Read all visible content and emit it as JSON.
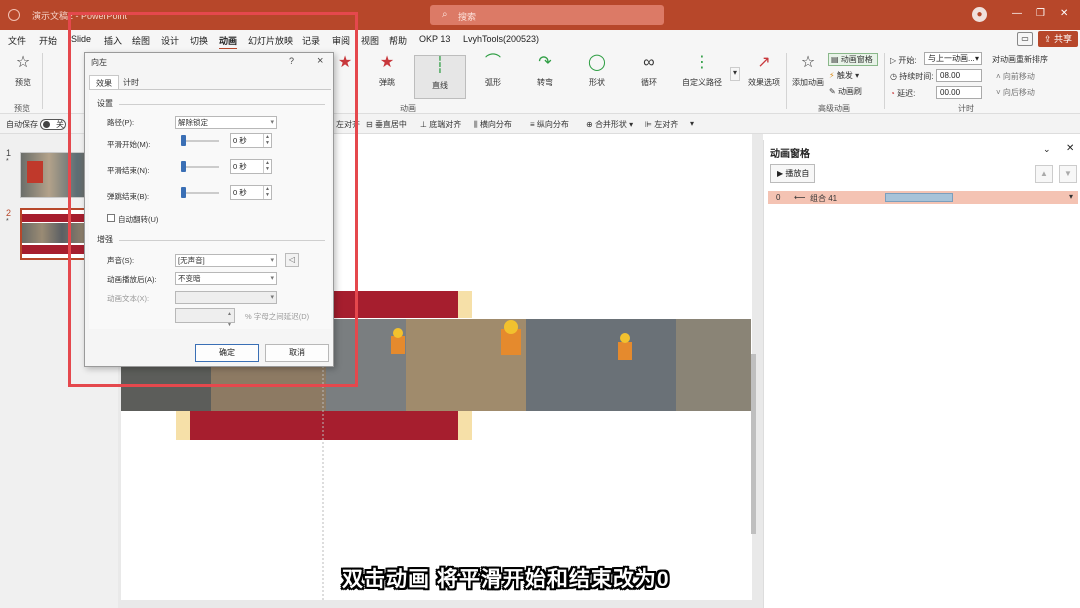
{
  "titlebar": {
    "title": "演示文稿2 - PowerPoint",
    "search_placeholder": "搜索"
  },
  "menu": {
    "items": [
      "文件",
      "开始",
      "Slide",
      "插入",
      "绘图",
      "设计",
      "切换",
      "动画",
      "幻灯片放映",
      "记录",
      "审阅",
      "视图",
      "帮助",
      "OKP 13",
      "LvyhTools(200523)"
    ],
    "active": "动画",
    "share": "共享"
  },
  "ribbon": {
    "preview": "预览",
    "preview_group": "预览",
    "effects": [
      "弹跳",
      "直线",
      "弧形",
      "转弯",
      "形状",
      "循环",
      "自定义路径"
    ],
    "effect_options": "效果选项",
    "animation_group": "动画",
    "add_animation": "添加动画",
    "anim_pane": "动画窗格",
    "trigger": "触发",
    "anim_painter": "动画刷",
    "advanced_group": "高级动画",
    "start_label": "开始:",
    "start_value": "与上一动画...",
    "duration_label": "持续时间:",
    "duration_value": "08.00",
    "delay_label": "延迟:",
    "delay_value": "00.00",
    "timing_group": "计时",
    "reorder_label": "对动画重新排序",
    "move_earlier": "向前移动",
    "move_later": "向后移动"
  },
  "toolbar2": {
    "autosave": "自动保存",
    "autosave_state": "关",
    "items": [
      "左对齐",
      "垂直居中",
      "底端对齐",
      "横向分布",
      "纵向分布",
      "合并形状",
      "左对齐"
    ]
  },
  "thumbnails": [
    {
      "num": "1",
      "star": "*"
    },
    {
      "num": "2",
      "star": "*"
    }
  ],
  "dialog": {
    "title": "向左",
    "help": "?",
    "close": "×",
    "tabs": [
      "效果",
      "计时"
    ],
    "settings_section": "设置",
    "path_label": "路径(P):",
    "path_value": "解除锁定",
    "smooth_start_label": "平滑开始(M):",
    "smooth_start_value": "0 秒",
    "smooth_end_label": "平滑结束(N):",
    "smooth_end_value": "0 秒",
    "bounce_end_label": "弹跳结束(B):",
    "bounce_end_value": "0 秒",
    "auto_reverse": "自动翻转(U)",
    "enhance_section": "增强",
    "sound_label": "声音(S):",
    "sound_value": "[无声音]",
    "after_anim_label": "动画播放后(A):",
    "after_anim_value": "不变暗",
    "anim_text_label": "动画文本(X):",
    "letter_delay": "% 字母之间延迟(D)",
    "ok": "确定",
    "cancel": "取消"
  },
  "anim_pane": {
    "title": "动画窗格",
    "play": "播放自",
    "item_index": "0",
    "item_name": "组合 41"
  },
  "caption": "双击动画 将平滑开始和结束改为0",
  "colors": {
    "accent": "#b7472a",
    "highlight_box": "#e5484d",
    "banner": "#a61e2e"
  }
}
